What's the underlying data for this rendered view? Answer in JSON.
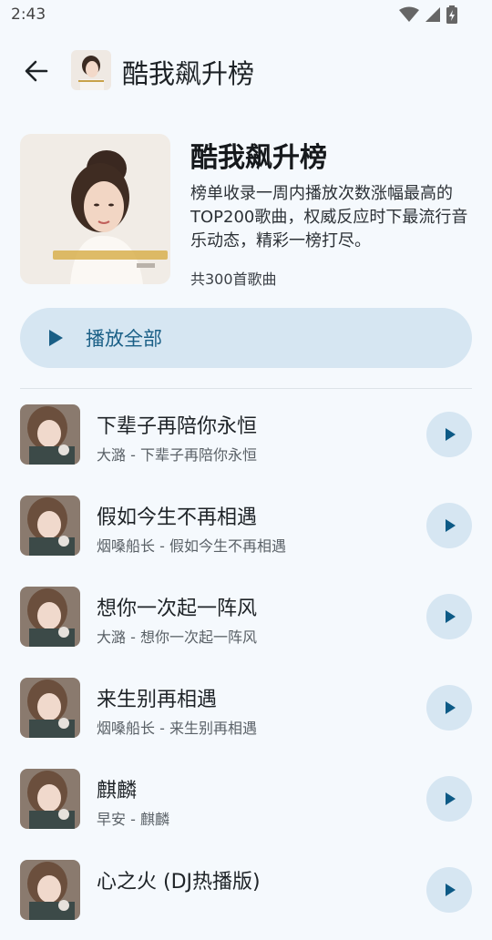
{
  "status_bar": {
    "time": "2:43"
  },
  "app_bar": {
    "title": "酷我飙升榜"
  },
  "hero": {
    "title": "酷我飙升榜",
    "description": "榜单收录一周内播放次数涨幅最高的TOP200歌曲，权威反应时下最流行音乐动态，精彩一榜打尽。",
    "count": "共300首歌曲"
  },
  "play_all": {
    "label": "播放全部"
  },
  "songs": [
    {
      "title": "下辈子再陪你永恒",
      "subtitle": "大潞 - 下辈子再陪你永恒"
    },
    {
      "title": "假如今生不再相遇",
      "subtitle": "烟嗓船长 - 假如今生不再相遇"
    },
    {
      "title": "想你一次起一阵风",
      "subtitle": "大潞 - 想你一次起一阵风"
    },
    {
      "title": "来生别再相遇",
      "subtitle": "烟嗓船长 - 来生别再相遇"
    },
    {
      "title": "麒麟",
      "subtitle": "早安 - 麒麟"
    },
    {
      "title": "心之火 (DJ热播版)",
      "subtitle": ""
    }
  ],
  "colors": {
    "accent": "#1a5f86",
    "button_bg": "#d6e6f2",
    "background": "#f5f9fd"
  }
}
